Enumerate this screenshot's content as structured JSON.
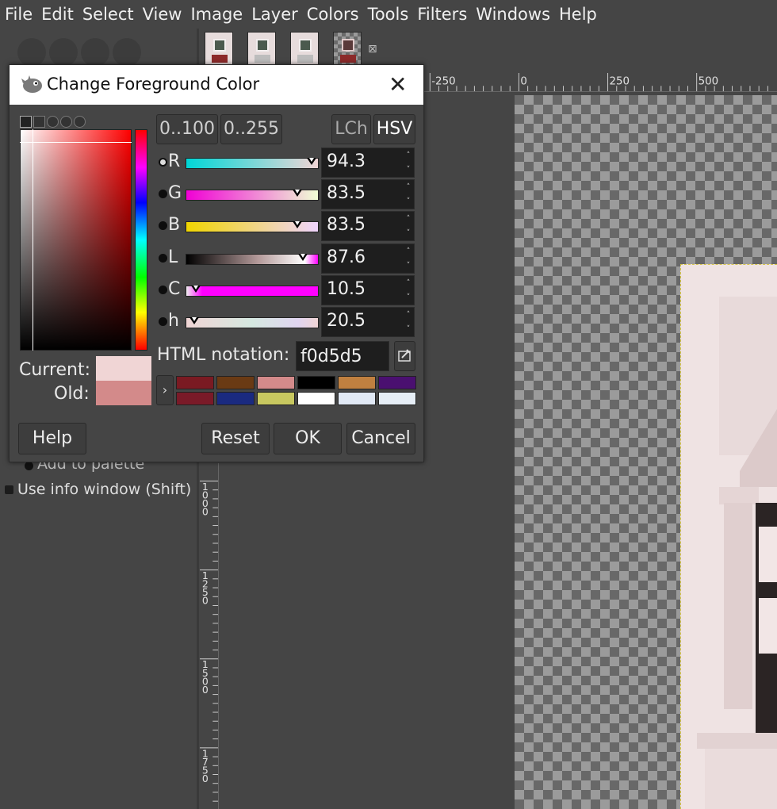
{
  "menubar": {
    "items": [
      "File",
      "Edit",
      "Select",
      "View",
      "Image",
      "Layer",
      "Colors",
      "Tools",
      "Filters",
      "Windows",
      "Help"
    ]
  },
  "tabs": {
    "close_glyph": "⊠"
  },
  "left_panel": {
    "add_to_palette": "Add to palette",
    "use_info_window": "Use info window  (Shift)"
  },
  "ruler_h": {
    "labels": [
      "-250",
      "0",
      "250",
      "500"
    ]
  },
  "ruler_v": {
    "labels": [
      "1000",
      "1250",
      "1500",
      "1750"
    ]
  },
  "dialog": {
    "title": "Change Foreground Color",
    "close_glyph": "✕",
    "range_100": "0..100",
    "range_255": "0..255",
    "lch": "LCh",
    "hsv": "HSV",
    "channels": [
      {
        "label": "R",
        "value": "94.3",
        "selected": true,
        "gradient": "linear-gradient(to right,#00d5d5,#f0d5d5)",
        "pos": 0.943
      },
      {
        "label": "G",
        "value": "83.5",
        "selected": false,
        "gradient": "linear-gradient(to right,#f000d5,#f0ffd5)",
        "pos": 0.835
      },
      {
        "label": "B",
        "value": "83.5",
        "selected": false,
        "gradient": "linear-gradient(to right,#f0d500,#f0d5ff)",
        "pos": 0.835
      },
      {
        "label": "L",
        "value": "87.6",
        "selected": false,
        "gradient": "linear-gradient(to right,#000,#b59b9b 55%,#fff 90%,#ff00ff)",
        "pos": 0.876
      },
      {
        "label": "C",
        "value": "10.5",
        "selected": false,
        "gradient": "linear-gradient(to right,#f0f0f0,#ff00ff 12%,#ff00ff)",
        "pos": 0.07
      },
      {
        "label": "h",
        "value": "20.5",
        "selected": false,
        "gradient": "linear-gradient(to right,#f0d5d5,#d5e8e0 50%,#e0d5f0 85%,#f0d5d5)",
        "pos": 0.057
      }
    ],
    "html_label": "HTML notation:",
    "html_value": "f0d5d5",
    "current_label": "Current:",
    "old_label": "Old:",
    "current_color": "#f0d5d5",
    "old_color": "#d38a8a",
    "history": [
      "#7a1a22",
      "#6a3a14",
      "#d38a8a",
      "#000000",
      "#c08040",
      "#4a1070",
      "#7a1a28",
      "#1a2a80",
      "#c8c860",
      "#ffffff",
      "#e0e8f4",
      "#e6eef6"
    ],
    "buttons": {
      "help": "Help",
      "reset": "Reset",
      "ok": "OK",
      "cancel": "Cancel"
    }
  }
}
